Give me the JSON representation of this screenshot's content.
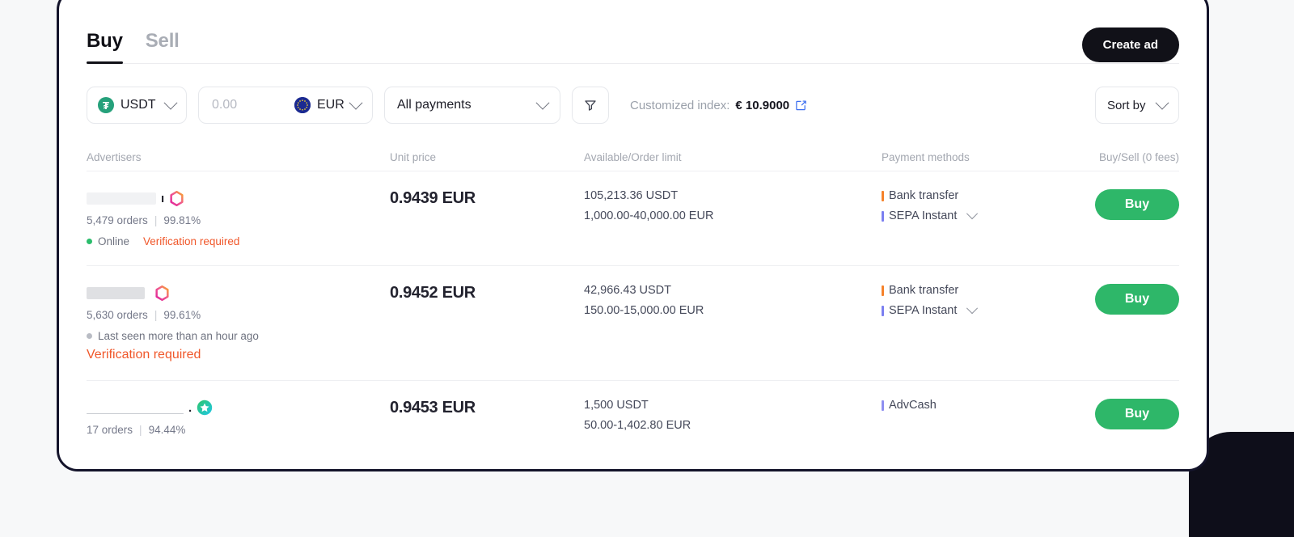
{
  "tabs": [
    {
      "label": "Buy",
      "active": true
    },
    {
      "label": "Sell",
      "active": false
    }
  ],
  "header": {
    "create_ad_label": "Create ad"
  },
  "filters": {
    "coin": {
      "label": "USDT",
      "icon": "tether-icon",
      "symbol": "₮"
    },
    "amount": {
      "value": "",
      "placeholder": "0.00"
    },
    "fiat": {
      "label": "EUR",
      "icon": "eur-flag-icon"
    },
    "payments": {
      "label": "All payments",
      "icon": "chevron-down-icon"
    },
    "filter_icon": "funnel-icon",
    "index_label": "Customized index:",
    "index_value": "€ 10.9000",
    "index_edit_icon": "edit-square-icon",
    "sort": {
      "label": "Sort by"
    }
  },
  "table": {
    "headers": {
      "advertisers": "Advertisers",
      "unit_price": "Unit price",
      "available": "Available/Order limit",
      "payment_methods": "Payment methods",
      "action": "Buy/Sell (0 fees)"
    },
    "rows": [
      {
        "advertiser": {
          "name_redacted": true,
          "name_tail": "ı",
          "badge": "hexagon-badge-icon",
          "orders": "5,479 orders",
          "separator": "|",
          "completion": "99.81%",
          "status": "Online",
          "status_state": "online",
          "verification": "Verification required",
          "verification_inline": true
        },
        "unit_price": "0.9439 EUR",
        "available": "105,213.36 USDT",
        "order_limit": "1,000.00-40,000.00 EUR",
        "payment_methods": [
          {
            "name": "Bank transfer",
            "color": "#f5822b"
          },
          {
            "name": "SEPA Instant",
            "color": "#7b7ff0",
            "expandable": true
          }
        ],
        "action_label": "Buy"
      },
      {
        "advertiser": {
          "name_redacted": true,
          "name_tail": "",
          "badge": "hexagon-badge-icon",
          "orders": "5,630 orders",
          "separator": "|",
          "completion": "99.61%",
          "status": "Last seen more than an hour ago",
          "status_state": "away",
          "verification": "Verification required",
          "verification_inline": false
        },
        "unit_price": "0.9452 EUR",
        "available": "42,966.43 USDT",
        "order_limit": "150.00-15,000.00 EUR",
        "payment_methods": [
          {
            "name": "Bank transfer",
            "color": "#f5822b"
          },
          {
            "name": "SEPA Instant",
            "color": "#7b7ff0",
            "expandable": true
          }
        ],
        "action_label": "Buy"
      },
      {
        "advertiser": {
          "name_redacted": true,
          "name_tail": ".",
          "badge": "star-badge-icon",
          "orders": "17 orders",
          "separator": "|",
          "completion": "94.44%",
          "status": "",
          "status_state": "none",
          "verification": "",
          "verification_inline": false
        },
        "unit_price": "0.9453 EUR",
        "available": "1,500 USDT",
        "order_limit": "50.00-1,402.80 EUR",
        "payment_methods": [
          {
            "name": "AdvCash",
            "color": "#8e8ff0"
          }
        ],
        "action_label": "Buy"
      }
    ]
  },
  "colors": {
    "accent_green": "#2eb769",
    "warn_orange": "#f0572a",
    "dark": "#14142b",
    "muted": "#a3a7b0"
  }
}
